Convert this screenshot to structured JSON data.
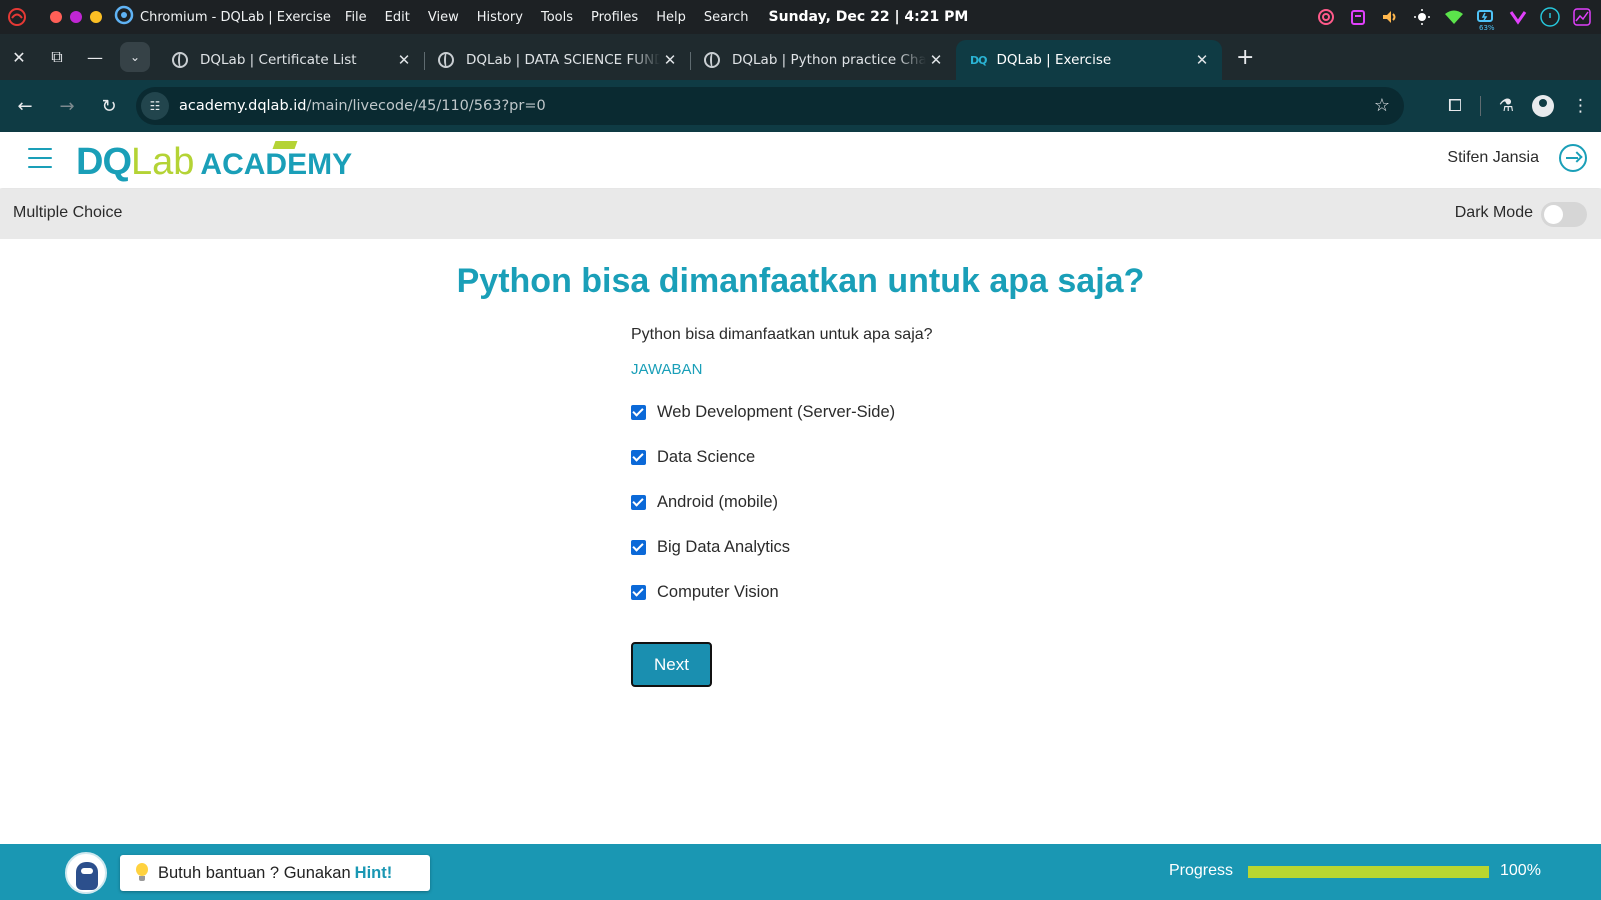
{
  "os_bar": {
    "app_title": "Chromium - DQLab | Exercise",
    "menu": [
      "File",
      "Edit",
      "View",
      "History",
      "Tools",
      "Profiles",
      "Help",
      "Search"
    ],
    "clock": "Sunday, Dec 22 | 4:21 PM",
    "battery_label": "63%"
  },
  "tabs": [
    {
      "title": "DQLab | Certificate List",
      "active": false
    },
    {
      "title": "DQLab | DATA SCIENCE FUND",
      "active": false
    },
    {
      "title": "DQLab | Python practice Cha",
      "active": false
    },
    {
      "title": "DQLab | Exercise",
      "active": true
    }
  ],
  "address_bar": {
    "host": "academy.dqlab.id",
    "path": "/main/livecode/45/110/563?pr=0"
  },
  "header": {
    "logo_dq": "DQ",
    "logo_lab": "Lab",
    "logo_academy": "ACADEMY",
    "user_name": "Stifen Jansia"
  },
  "subheader": {
    "section_label": "Multiple Choice",
    "dark_mode_label": "Dark Mode",
    "dark_mode_on": false
  },
  "main": {
    "title": "Python bisa dimanfaatkan untuk apa saja?",
    "question": "Python bisa dimanfaatkan untuk apa saja?",
    "answer_label": "JAWABAN",
    "options": [
      {
        "label": "Web Development (Server-Side)",
        "checked": true
      },
      {
        "label": "Data Science",
        "checked": true
      },
      {
        "label": "Android (mobile)",
        "checked": true
      },
      {
        "label": "Big Data Analytics",
        "checked": true
      },
      {
        "label": "Computer Vision",
        "checked": true
      }
    ],
    "next_label": "Next"
  },
  "footer": {
    "hint_text": "Butuh bantuan ? Gunakan",
    "hint_word": "Hint!",
    "progress_label": "Progress",
    "progress_value": 100,
    "progress_text": "100%"
  },
  "colors": {
    "brand": "#1a9fb8",
    "brand_lime": "#b4d335",
    "footer_bg": "#1a97b3",
    "checkbox": "#0b69d8"
  }
}
